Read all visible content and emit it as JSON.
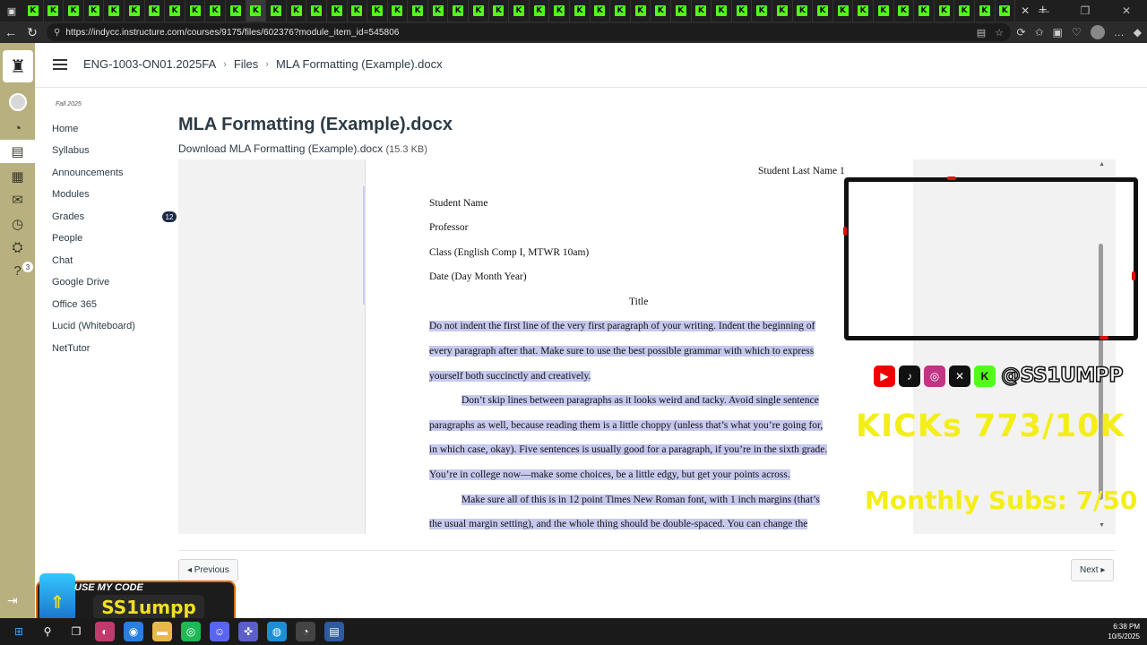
{
  "browser": {
    "url": "https://indycc.instructure.com/courses/9175/files/602376?module_item_id=545806",
    "tab_count": 49,
    "tab_favicon_letter": "K"
  },
  "header": {
    "breadcrumbs": [
      "ENG-1003-ON01.2025FA",
      "Files",
      "MLA Formatting (Example).docx"
    ]
  },
  "course_nav": {
    "term": "Fall 2025",
    "items": [
      {
        "label": "Home"
      },
      {
        "label": "Syllabus"
      },
      {
        "label": "Announcements"
      },
      {
        "label": "Modules"
      },
      {
        "label": "Grades",
        "badge": "12"
      },
      {
        "label": "People"
      },
      {
        "label": "Chat"
      },
      {
        "label": "Google Drive"
      },
      {
        "label": "Office 365"
      },
      {
        "label": "Lucid (Whiteboard)"
      },
      {
        "label": "NetTutor"
      }
    ]
  },
  "global_nav": {
    "help_badge": "3"
  },
  "file": {
    "title": "MLA Formatting (Example).docx",
    "download_label": "Download MLA Formatting (Example).docx",
    "size": "(15.3 KB)"
  },
  "document": {
    "header_right": "Student Last Name 1",
    "heading_lines": [
      "Student Name",
      "Professor",
      "Class (English Comp I, MTWR 10am)",
      "Date (Day Month Year)"
    ],
    "title": "Title",
    "body_lines": [
      "Do not indent the first line of the very first paragraph of your writing. Indent the beginning of",
      "every paragraph after that. Make sure to use the best possible grammar with which to express",
      "yourself both succinctly and creatively.",
      "Don’t skip lines between paragraphs as it looks weird and tacky. Avoid single sentence",
      "paragraphs as well, because reading them is a little choppy (unless that’s what you’re going for,",
      "in which case, okay). Five sentences is usually good for a paragraph, if you’re in the sixth grade.",
      "You’re in college now—make some choices, be a little edgy, but get your points across.",
      "Make sure all of this is in 12 point Times New Roman font, with 1 inch margins (that’s",
      "the usual margin setting), and the whole thing should be double-spaced. You can change the"
    ]
  },
  "pager": {
    "previous": "◂ Previous",
    "next": "Next ▸"
  },
  "overlay": {
    "handle": "@SS1UMPP",
    "kicks": "KICKs 773/10K",
    "subs": "Monthly Subs: 7/50",
    "promo_top": "USE MY CODE",
    "promo_code": "SS1umpp"
  },
  "taskbar": {
    "time": "6:38 PM",
    "date": "10/5/2025"
  },
  "colors": {
    "global_nav_bg": "#b8b07f",
    "highlight": "#c7c8ee",
    "kick_green": "#53fc18",
    "overlay_yellow": "#f4ee18"
  }
}
